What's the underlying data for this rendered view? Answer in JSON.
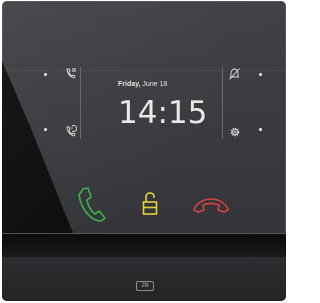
{
  "screen": {
    "date_day": "Friday,",
    "date_rest": " June 18",
    "time": "14:15"
  },
  "brand": {
    "logo_text": "2N"
  },
  "left_buttons": [
    {
      "icon": "missed-call-list-icon"
    },
    {
      "icon": "call-history-icon"
    }
  ],
  "right_buttons": [
    {
      "icon": "bell-off-icon"
    },
    {
      "icon": "settings-gear-icon"
    }
  ],
  "call_buttons": {
    "answer_color": "#3fb24b",
    "unlock_color": "#e6d13a",
    "hangup_color": "#d8433e"
  }
}
